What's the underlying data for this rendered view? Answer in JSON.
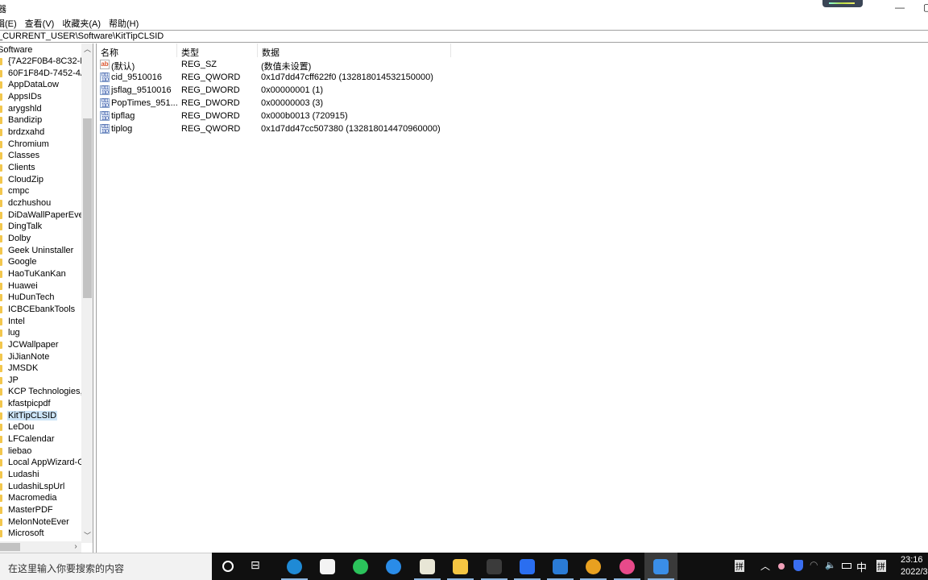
{
  "window": {
    "title": "编辑器",
    "title_visible": "器",
    "minimize_icon": "minimize-icon"
  },
  "menu": [
    {
      "label": "辑(E)"
    },
    {
      "label": "查看(V)"
    },
    {
      "label": "收藏夹(A)"
    },
    {
      "label": "帮助(H)"
    }
  ],
  "address": "_CURRENT_USER\\Software\\KitTipCLSID",
  "tree": {
    "root": "Software",
    "selected": "KitTipCLSID",
    "items": [
      "{7A22F0B4-8C32-E",
      "60F1F84D-7452-4A",
      "AppDataLow",
      "AppsIDs",
      "arygshld",
      "Bandizip",
      "brdzxahd",
      "Chromium",
      "Classes",
      "Clients",
      "CloudZip",
      "cmpc",
      "dczhushou",
      "DiDaWallPaperEver",
      "DingTalk",
      "Dolby",
      "Geek Uninstaller",
      "Google",
      "HaoTuKanKan",
      "Huawei",
      "HuDunTech",
      "ICBCEbankTools",
      "Intel",
      "lug",
      "JCWallpaper",
      "JiJianNote",
      "JMSDK",
      "JP",
      "KCP Technologies,",
      "kfastpicpdf",
      "KitTipCLSID",
      "LeDou",
      "LFCalendar",
      "liebao",
      "Local AppWizard-G",
      "Ludashi",
      "LudashiLspUrl",
      "Macromedia",
      "MasterPDF",
      "MelonNoteEver",
      "Microsoft"
    ]
  },
  "values": {
    "columns": {
      "name": "名称",
      "type": "类型",
      "data": "数据"
    },
    "rows": [
      {
        "icon": "string-value-icon",
        "icon_text": "ab",
        "name": "(默认)",
        "type": "REG_SZ",
        "data": "(数值未设置)"
      },
      {
        "icon": "binary-value-icon",
        "icon_text": "011 110",
        "name": "cid_9510016",
        "type": "REG_QWORD",
        "data": "0x1d7dd47cff622f0 (132818014532150000)"
      },
      {
        "icon": "binary-value-icon",
        "icon_text": "011 110",
        "name": "jsflag_9510016",
        "type": "REG_DWORD",
        "data": "0x00000001 (1)"
      },
      {
        "icon": "binary-value-icon",
        "icon_text": "011 110",
        "name": "PopTimes_951...",
        "type": "REG_DWORD",
        "data": "0x00000003 (3)"
      },
      {
        "icon": "binary-value-icon",
        "icon_text": "011 110",
        "name": "tipflag",
        "type": "REG_DWORD",
        "data": "0x000b0013 (720915)"
      },
      {
        "icon": "binary-value-icon",
        "icon_text": "011 110",
        "name": "tiplog",
        "type": "REG_QWORD",
        "data": "0x1d7dd47cc507380 (132818014470960000)"
      }
    ]
  },
  "taskbar": {
    "search_placeholder": "在这里输入你要搜索的内容",
    "apps": [
      {
        "name": "edge",
        "color": "#1f8ad6",
        "open": true
      },
      {
        "name": "store",
        "color": "#f3f3f3",
        "open": false
      },
      {
        "name": "wechat",
        "color": "#2bc25b",
        "open": false
      },
      {
        "name": "dingtalk",
        "color": "#2a8ce8",
        "open": false
      },
      {
        "name": "app-colorful",
        "color": "#e8e6d6",
        "open": true
      },
      {
        "name": "file-explorer",
        "color": "#f5c542",
        "open": true
      },
      {
        "name": "game-app",
        "color": "#3b3b3b",
        "open": true
      },
      {
        "name": "security-shield",
        "color": "#2a6ef0",
        "open": true
      },
      {
        "name": "photos",
        "color": "#2a7bd6",
        "open": true
      },
      {
        "name": "browser-360",
        "color": "#e8a020",
        "open": true
      },
      {
        "name": "flower-app",
        "color": "#e84a8a",
        "open": true
      },
      {
        "name": "regedit",
        "color": "#3a8ee8",
        "open": true,
        "active": true
      }
    ],
    "tray": {
      "ime_left": "拼",
      "language": "中",
      "ime_right": "拼",
      "time": "23:16",
      "date": "2022/3"
    }
  }
}
